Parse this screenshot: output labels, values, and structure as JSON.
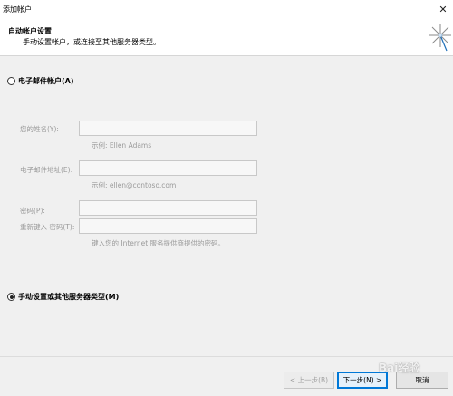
{
  "window": {
    "title": "添加帐户",
    "close_glyph": "✕"
  },
  "header": {
    "title": "自动帐户设置",
    "subtitle": "手动设置帐户，或连接至其他服务器类型。",
    "icon": "wizard-sparkle-icon"
  },
  "options": {
    "email_account": {
      "label": "电子邮件帐户(A)",
      "checked": false
    },
    "manual_setup": {
      "label": "手动设置或其他服务器类型(M)",
      "checked": true
    }
  },
  "form": {
    "name": {
      "label": "您的姓名(Y):",
      "value": "",
      "hint": "示例: Ellen Adams"
    },
    "email": {
      "label": "电子邮件地址(E):",
      "value": "",
      "hint": "示例: ellen@contoso.com"
    },
    "password": {
      "label": "密码(P):",
      "value": ""
    },
    "password_confirm": {
      "label": "重新键入 密码(T):",
      "value": "",
      "hint": "键入您的 Internet 服务提供商提供的密码。"
    }
  },
  "footer": {
    "back_label": "< 上一步(B)",
    "next_label": "下一步(N) >",
    "cancel_label": "取消"
  },
  "watermark": {
    "text": "Bai经验"
  }
}
